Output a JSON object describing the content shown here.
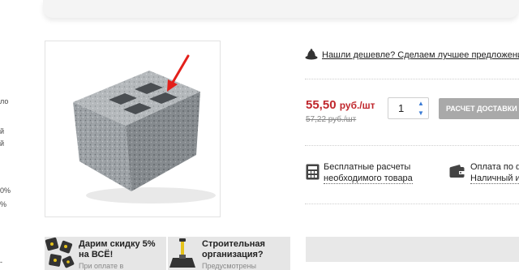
{
  "left_edge_fragments": [
    "ло",
    "й",
    "й",
    "0%",
    "%",
    "-"
  ],
  "cheaper": {
    "icon": "cheaper-badge-icon",
    "text": "Нашли дешевле? Сделаем лучшее предложение"
  },
  "price": {
    "current_value": "55,50",
    "current_unit": "руб./шт",
    "old": "57,22 руб./шт"
  },
  "quantity": {
    "value": "1"
  },
  "calc_button": {
    "label": "РАСЧЕТ ДОСТАВКИ"
  },
  "features": [
    {
      "icon": "calculator-icon",
      "line1": "Бесплатные расчеты",
      "line2": "необходимого товара"
    },
    {
      "icon": "wallet-icon",
      "line1": "Оплата по ф",
      "line2": "Наличный и"
    }
  ],
  "promos": [
    {
      "icon": "dice-discount-icon",
      "title1": "Дарим скидку 5%",
      "title2": "на ВСЁ!",
      "sub": "При оплате в"
    },
    {
      "icon": "builder-trowel-icon",
      "title1": "Строительная",
      "title2": "организация?",
      "sub": "Предусмотрены"
    }
  ],
  "colors": {
    "price_red": "#c0272d",
    "button_grey": "#a9a9a9",
    "accent_blue": "#3a7bd5"
  }
}
